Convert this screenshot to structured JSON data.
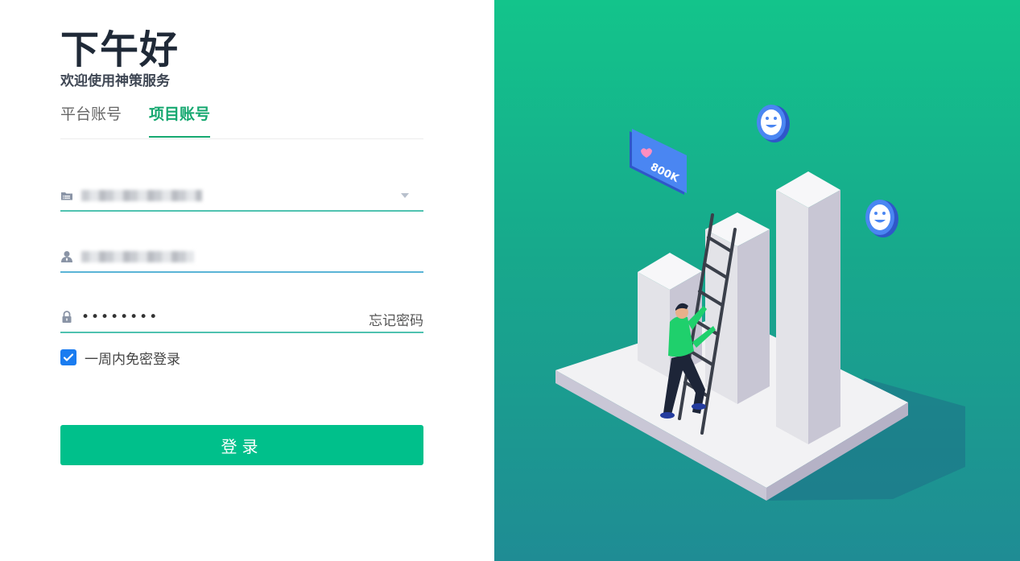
{
  "greeting": "下午好",
  "subtitle": "欢迎使用神策服务",
  "tabs": [
    {
      "label": "平台账号",
      "active": false
    },
    {
      "label": "项目账号",
      "active": true
    }
  ],
  "project_field": {
    "icon": "folder-list-icon"
  },
  "username_field": {
    "icon": "user-icon"
  },
  "password_field": {
    "icon": "lock-icon",
    "value": "••••••••",
    "forgot_label": "忘记密码"
  },
  "remember": {
    "label": "一周内免密登录",
    "checked": true
  },
  "login_button": {
    "label": "登录"
  },
  "illustration": {
    "badge_text": "800K"
  },
  "colors": {
    "accent": "#00c08b",
    "tab_active": "#16a870",
    "checkbox": "#1a7cf0"
  }
}
